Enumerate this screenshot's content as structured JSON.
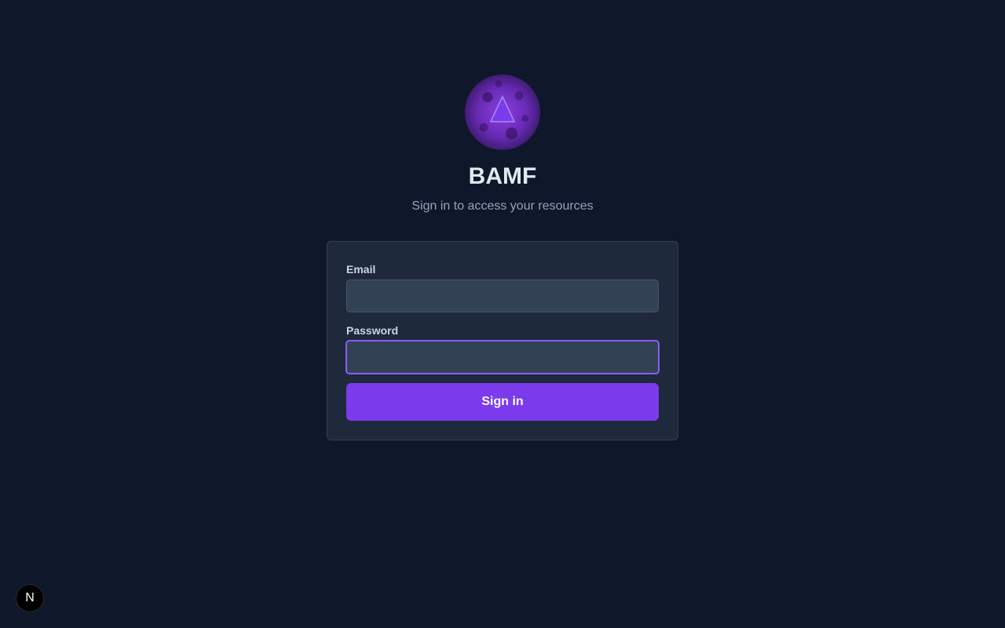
{
  "app": {
    "title": "BAMF",
    "subtitle": "Sign in to access your resources",
    "logo_icon": "triangle-orb-logo-icon"
  },
  "form": {
    "email_label": "Email",
    "email_value": "",
    "password_label": "Password",
    "password_value": "",
    "submit_label": "Sign in"
  },
  "dev_badge": {
    "letter": "N",
    "icon": "nextjs-icon"
  },
  "colors": {
    "background": "#0f172a",
    "card": "#1e293b",
    "input": "#334155",
    "accent": "#7c3aed",
    "focus": "#8b5cf6"
  }
}
